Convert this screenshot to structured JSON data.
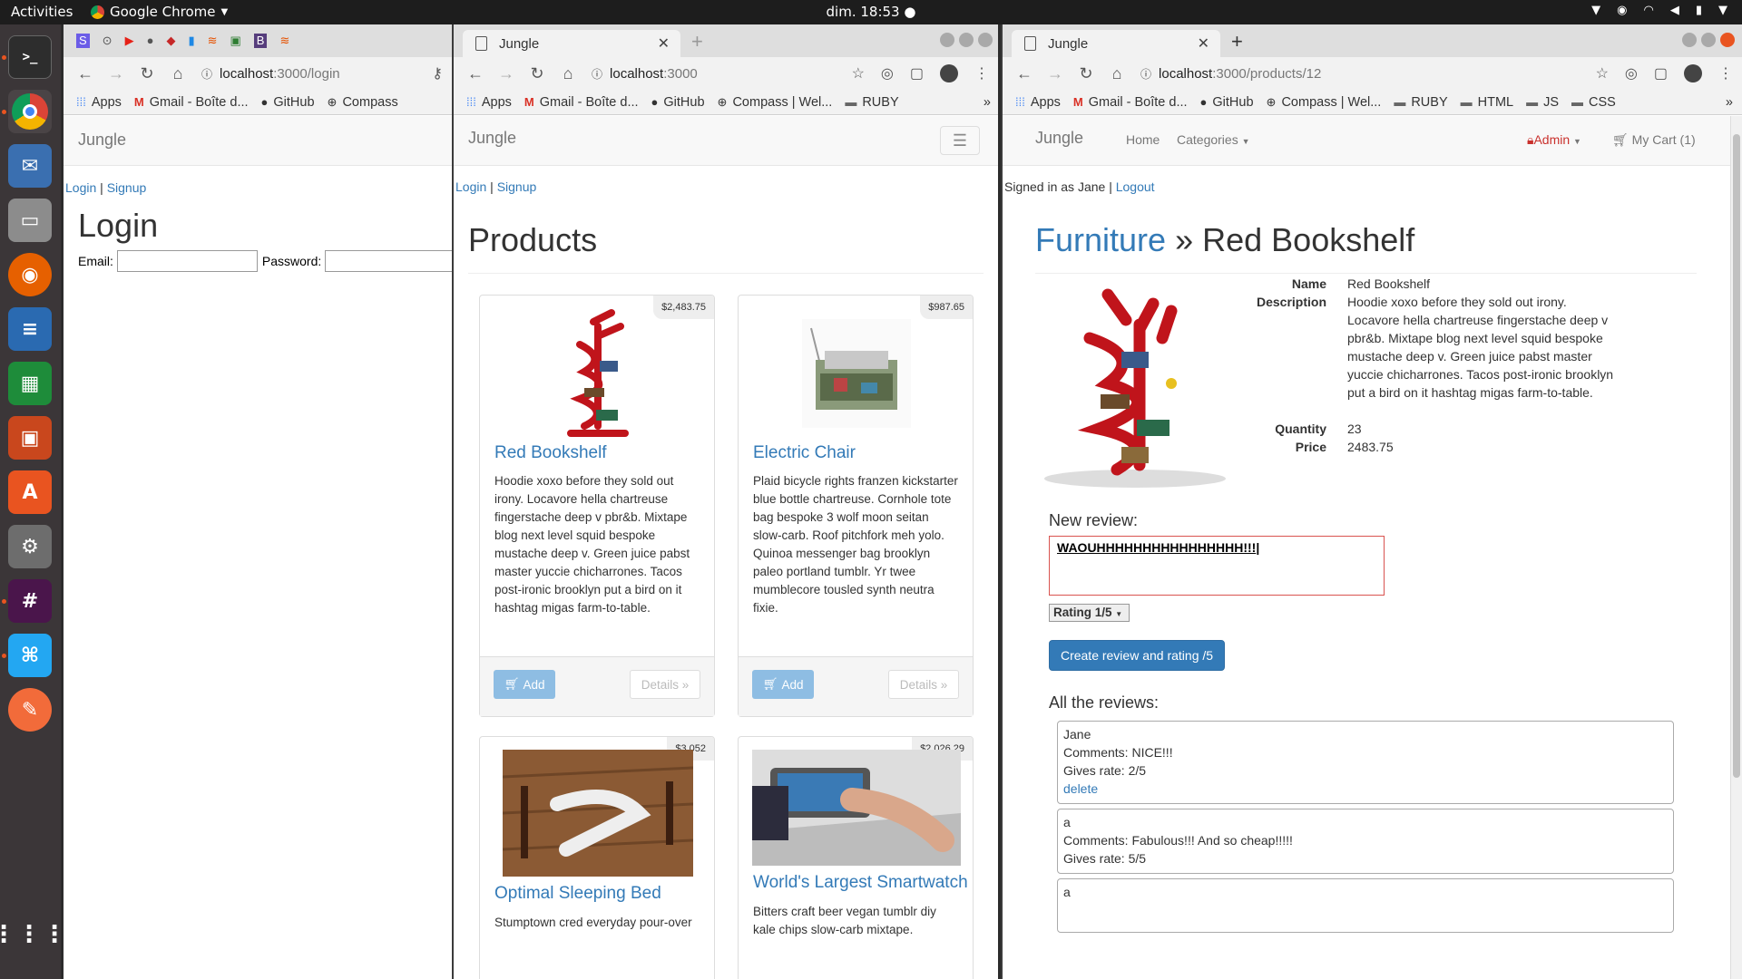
{
  "topbar": {
    "activities": "Activities",
    "app": "Google Chrome",
    "clock": "dim. 18:53"
  },
  "windows": {
    "login": {
      "tab_title": "",
      "url_host": "localhost",
      "url_path": ":3000/login",
      "bookmarks": [
        "Apps",
        "Gmail - Boîte d...",
        "GitHub",
        "Compass"
      ],
      "brand": "Jungle",
      "login_link": "Login",
      "separator": "|",
      "signup_link": "Signup",
      "heading": "Login",
      "email_label": "Email:",
      "password_label": "Password:"
    },
    "products": {
      "tab_title": "Jungle",
      "url_host": "localhost",
      "url_path": ":3000",
      "bookmarks": [
        "Apps",
        "Gmail - Boîte d...",
        "GitHub",
        "Compass | Wel...",
        "RUBY"
      ],
      "brand": "Jungle",
      "login_link": "Login",
      "separator": "|",
      "signup_link": "Signup",
      "heading": "Products",
      "add_label": "Add",
      "details_label": "Details »",
      "items": [
        {
          "name": "Red Bookshelf",
          "price": "$2,483.75",
          "desc": "Hoodie xoxo before they sold out irony. Locavore hella chartreuse fingerstache deep v pbr&b. Mixtape blog next level squid bespoke mustache deep v. Green juice pabst master yuccie chicharrones. Tacos post-ironic brooklyn put a bird on it hashtag migas farm-to-table."
        },
        {
          "name": "Electric Chair",
          "price": "$987.65",
          "desc": "Plaid bicycle rights franzen kickstarter blue bottle chartreuse. Cornhole tote bag bespoke 3 wolf moon seitan slow-carb. Roof pitchfork meh yolo. Quinoa messenger bag brooklyn paleo portland tumblr. Yr twee mumblecore tousled synth neutra fixie."
        },
        {
          "name": "Optimal Sleeping Bed",
          "price": "$3,052",
          "desc": "Stumptown cred everyday pour-over"
        },
        {
          "name": "World's Largest Smartwatch",
          "price": "$2,026.29",
          "desc": "Bitters craft beer vegan tumblr diy kale chips slow-carb mixtape."
        }
      ]
    },
    "detail": {
      "tab_title": "Jungle",
      "url_host": "localhost",
      "url_path": ":3000/products/12",
      "bookmarks": [
        "Apps",
        "Gmail - Boîte d...",
        "GitHub",
        "Compass | Wel...",
        "RUBY",
        "HTML",
        "JS",
        "CSS"
      ],
      "brand": "Jungle",
      "nav_home": "Home",
      "nav_categories": "Categories",
      "nav_admin": "Admin",
      "nav_cart": "My Cart (1)",
      "signed_in": "Signed in as Jane",
      "separator": "|",
      "logout": "Logout",
      "category": "Furniture",
      "crumb_sep": "»",
      "product_name": "Red Bookshelf",
      "labels": {
        "name": "Name",
        "description": "Description",
        "quantity": "Quantity",
        "price": "Price"
      },
      "values": {
        "name": "Red Bookshelf",
        "description": "Hoodie xoxo before they sold out irony. Locavore hella chartreuse fingerstache deep v pbr&b. Mixtape blog next level squid bespoke mustache deep v. Green juice pabst master yuccie chicharrones. Tacos post-ironic brooklyn put a bird on it hashtag migas farm-to-table.",
        "quantity": "23",
        "price": "2483.75"
      },
      "new_review_label": "New review:",
      "review_text": "WAOUHHHHHHHHHHHHHHHH!!!",
      "rating_select": "Rating 1/5",
      "submit_label": "Create review and rating /5",
      "all_reviews_label": "All the reviews:",
      "reviews": [
        {
          "user": "Jane",
          "comment": "Comments: NICE!!!",
          "rate": "Gives rate: 2/5",
          "delete": "delete"
        },
        {
          "user": "a",
          "comment": "Comments: Fabulous!!! And so cheap!!!!!",
          "rate": "Gives rate: 5/5"
        },
        {
          "user": "a"
        }
      ]
    }
  }
}
